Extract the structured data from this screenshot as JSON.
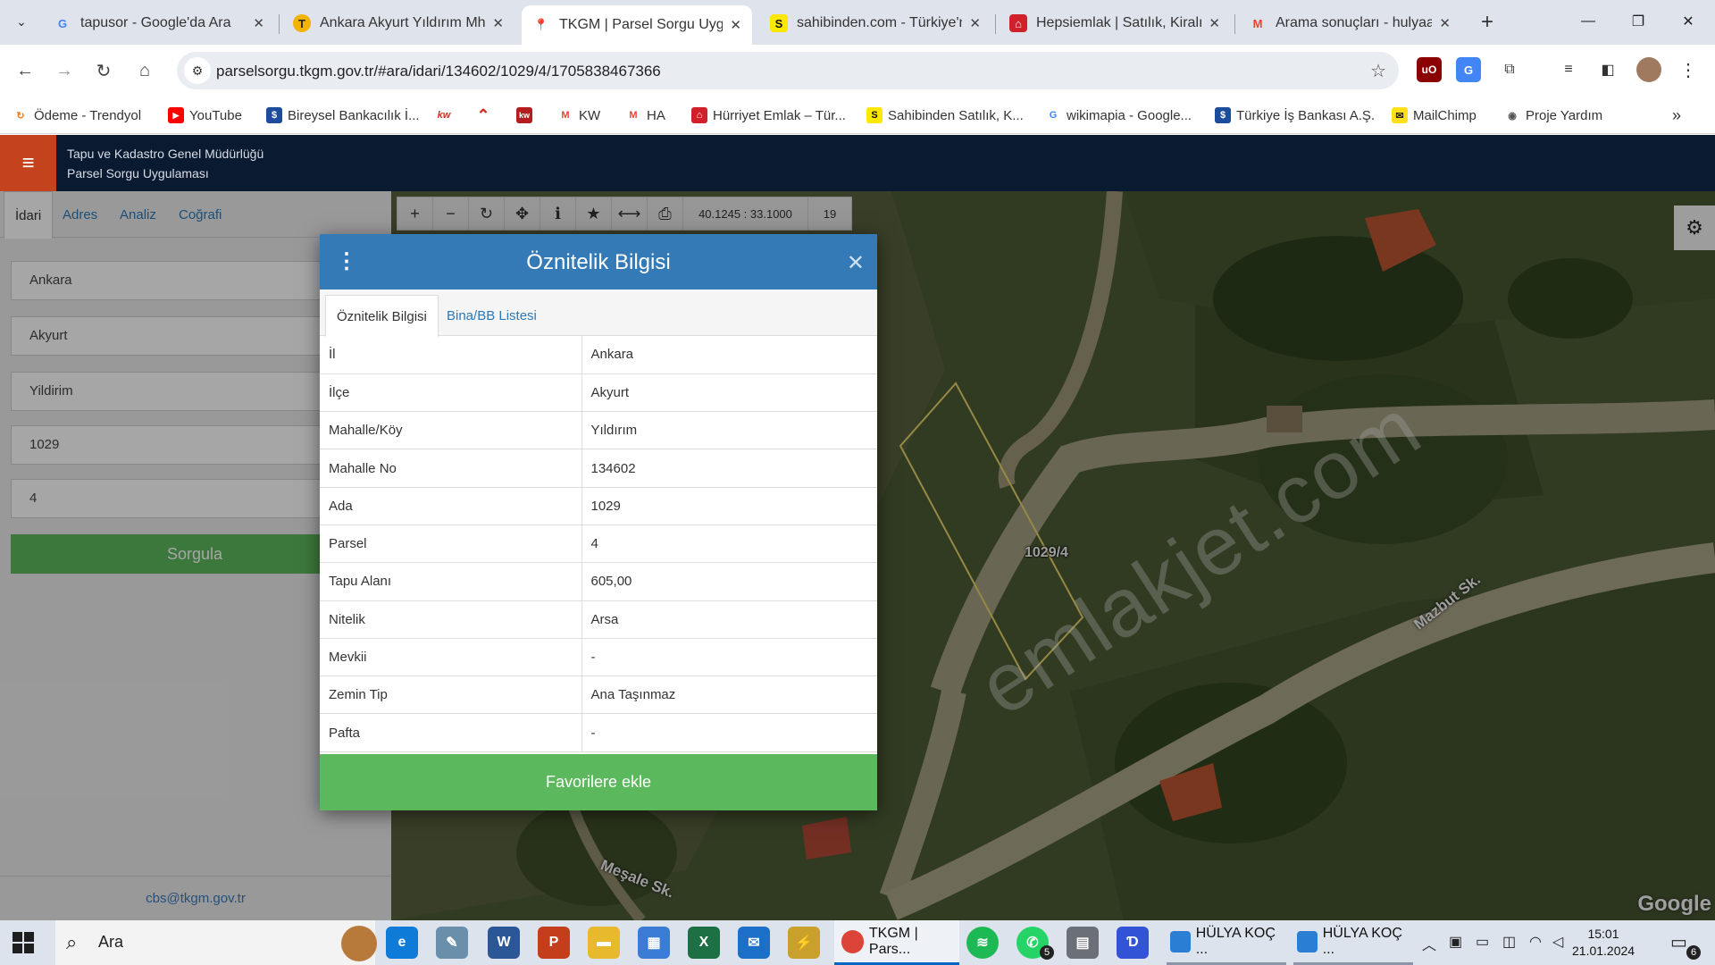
{
  "browser": {
    "tabs": [
      {
        "title": "tapusor - Google'da Ara",
        "favicon": "G",
        "color": "#4285f4"
      },
      {
        "title": "Ankara Akyurt Yıldırım Mh.",
        "favicon": "T",
        "color": "#f2b200"
      },
      {
        "title": "TKGM | Parsel Sorgu Uygul",
        "favicon": "📍",
        "color": "#333333"
      },
      {
        "title": "sahibinden.com - Türkiye'n",
        "favicon": "S",
        "color": "#ffe800"
      },
      {
        "title": "Hepsiemlak | Satılık, Kiralık",
        "favicon": "⌂",
        "color": "#d0202a"
      },
      {
        "title": "Arama sonuçları - hulyaak",
        "favicon": "M",
        "color": "#ea4335"
      }
    ],
    "url": "parselsorgu.tkgm.gov.tr/#ara/idari/134602/1029/4/1705838467366",
    "bookmarks": [
      {
        "label": "Ödeme - Trendyol",
        "icon": "↻",
        "color": "#f27a1a"
      },
      {
        "label": "YouTube",
        "icon": "▶",
        "color": "#ff0000"
      },
      {
        "label": "Bireysel Bankacılık İ...",
        "icon": "$",
        "color": "#1c4c9c"
      },
      {
        "label": "",
        "icon": "kw",
        "color": "#d52b1e"
      },
      {
        "label": "",
        "icon": "⌃",
        "color": "#d52b1e"
      },
      {
        "label": "",
        "icon": "kw",
        "color": "#b21e1e"
      },
      {
        "label": "KW",
        "icon": "M",
        "color": "#ea4335"
      },
      {
        "label": "HA",
        "icon": "M",
        "color": "#ea4335"
      },
      {
        "label": "Hürriyet Emlak – Tür...",
        "icon": "⌂",
        "color": "#d0202a"
      },
      {
        "label": "Sahibinden Satılık, K...",
        "icon": "S",
        "color": "#ffe800"
      },
      {
        "label": "wikimapia - Google...",
        "icon": "G",
        "color": "#4285f4"
      },
      {
        "label": "Türkiye İş Bankası A.Ş.",
        "icon": "$",
        "color": "#1c4c9c"
      },
      {
        "label": "MailChimp",
        "icon": "✉",
        "color": "#ffe01b"
      },
      {
        "label": "Proje Yardım",
        "icon": "◉",
        "color": "#555555"
      }
    ]
  },
  "app": {
    "title_line1": "Tapu ve Kadastro Genel Müdürlüğü",
    "title_line2": "Parsel Sorgu Uygulaması",
    "side_tabs": [
      "İdari",
      "Adres",
      "Analiz",
      "Coğrafi"
    ],
    "fields": [
      "Ankara",
      "Akyurt",
      "Yildirim",
      "1029",
      "4"
    ],
    "query_button": "Sorgula",
    "footer_email": "cbs@tkgm.gov.tr"
  },
  "map": {
    "coord_readout": "40.1245 : 33.1000",
    "zoom_level": "19",
    "parcel_label": "1029/4",
    "streets": [
      "Mazbut Sk.",
      "Meşale Sk."
    ],
    "attribution": "Google",
    "watermark": "emlakjet.com"
  },
  "modal": {
    "title": "Öznitelik Bilgisi",
    "tabs": [
      "Öznitelik Bilgisi",
      "Bina/BB Listesi"
    ],
    "rows": [
      {
        "key": "İl",
        "value": "Ankara"
      },
      {
        "key": "İlçe",
        "value": "Akyurt"
      },
      {
        "key": "Mahalle/Köy",
        "value": "Yıldırım"
      },
      {
        "key": "Mahalle No",
        "value": "134602"
      },
      {
        "key": "Ada",
        "value": "1029"
      },
      {
        "key": "Parsel",
        "value": "4"
      },
      {
        "key": "Tapu Alanı",
        "value": "605,00"
      },
      {
        "key": "Nitelik",
        "value": "Arsa"
      },
      {
        "key": "Mevkii",
        "value": "-"
      },
      {
        "key": "Zemin Tip",
        "value": "Ana Taşınmaz"
      },
      {
        "key": "Pafta",
        "value": "-"
      }
    ],
    "favorite_button": "Favorilere ekle"
  },
  "taskbar": {
    "search_label": "Ara",
    "running": [
      {
        "label": "TKGM | Pars...",
        "active": true
      },
      {
        "label": "HÜLYA KOÇ ...",
        "active": false
      },
      {
        "label": "HÜLYA KOÇ ...",
        "active": false
      }
    ],
    "whatsapp_badge": "5",
    "time": "15:01",
    "date": "21.01.2024",
    "notification_count": "6"
  },
  "colors": {
    "header_bg": "#0a1a30",
    "accent_orange": "#c5431c",
    "modal_header": "#337ab7",
    "button_green": "#5cb85c",
    "link_blue": "#2c79b8"
  }
}
